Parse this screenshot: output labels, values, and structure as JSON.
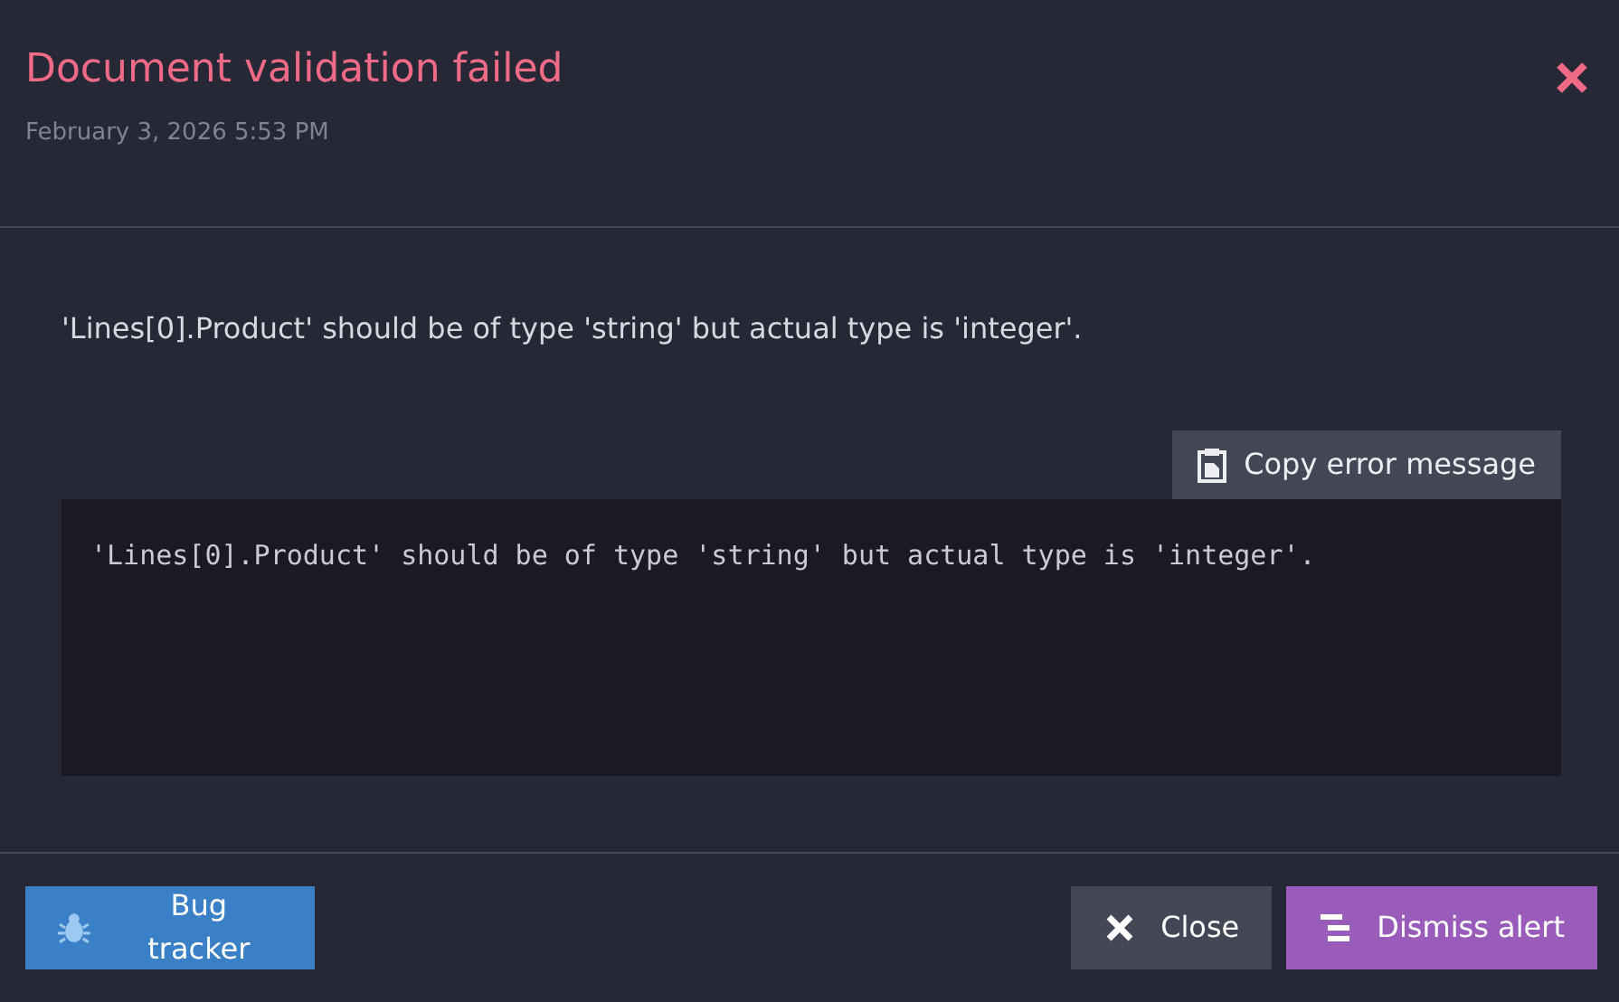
{
  "dialog": {
    "title": "Document validation failed",
    "timestamp": "February 3, 2026 5:53 PM",
    "message": "'Lines[0].Product' should be of type 'string' but actual type is 'integer'.",
    "copy_button": "Copy error message",
    "code": "'Lines[0].Product' should be of type 'string' but actual type is 'integer'."
  },
  "footer": {
    "left_button": {
      "label": "Bug tracker"
    },
    "right_buttons": [
      {
        "label": "Close",
        "kind": "close"
      },
      {
        "label": "Dismiss alert",
        "kind": "dismiss"
      }
    ]
  }
}
